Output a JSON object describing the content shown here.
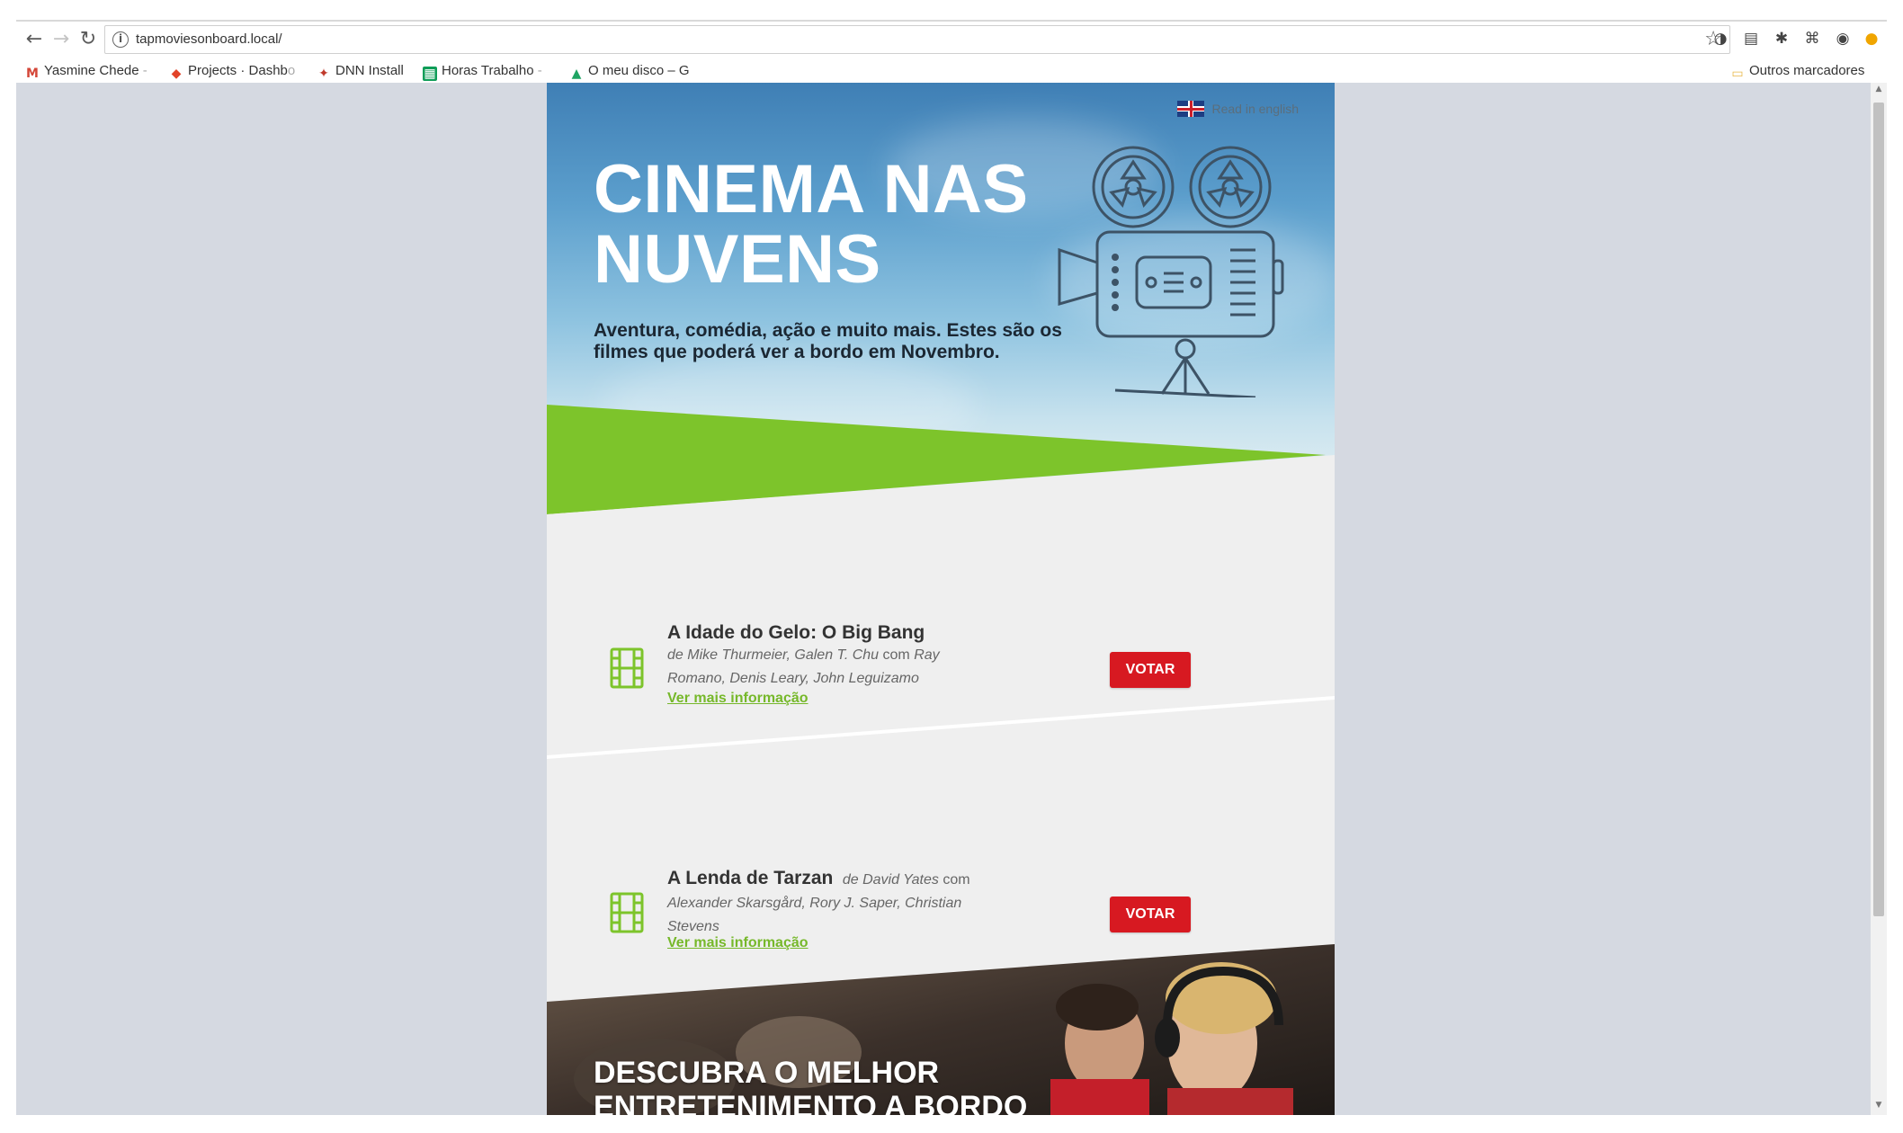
{
  "browser": {
    "url": "tapmoviesonboard.local/",
    "bookmarks": [
      {
        "label": "Yasmine Chede",
        "suffix": " -",
        "icon": "gmail-icon"
      },
      {
        "label": "Projects · Dashb",
        "suffix": "o",
        "icon": "gitlab-icon"
      },
      {
        "label": "DNN Install",
        "suffix": "",
        "icon": "dnn-icon"
      },
      {
        "label": "Horas Trabalho",
        "suffix": " -",
        "icon": "sheets-icon"
      },
      {
        "label": "O meu disco – G",
        "suffix": "",
        "icon": "drive-icon"
      }
    ],
    "other_bookmarks": "Outros marcadores"
  },
  "email": {
    "lang_link": "Read in english",
    "hero_title": "CINEMA NAS NUVENS",
    "hero_subtitle": "Aventura, comédia, ação e muito mais. Estes são os filmes que poderá ver a bordo em Novembro.",
    "movies": [
      {
        "title": "A Idade do Gelo: O Big Bang",
        "by_prefix": "de",
        "directors": "Mike Thurmeier, Galen T. Chu",
        "with": "com",
        "cast": "Ray Romano, Denis Leary, John Leguizamo",
        "more": "Ver mais informação",
        "vote": "VOTAR"
      },
      {
        "title": "A Lenda de Tarzan",
        "by_prefix": "de",
        "directors": "David Yates",
        "with": "com",
        "cast": "Alexander Skarsgård, Rory J. Saper, Christian Stevens",
        "more": "Ver mais informação",
        "vote": "VOTAR"
      }
    ],
    "promo_title": "DESCUBRA O MELHOR ENTRETENIMENTO A BORDO"
  },
  "colors": {
    "accent_green": "#76b82a",
    "vote_red": "#d71921",
    "sky_blue": "#5c9fcd"
  }
}
